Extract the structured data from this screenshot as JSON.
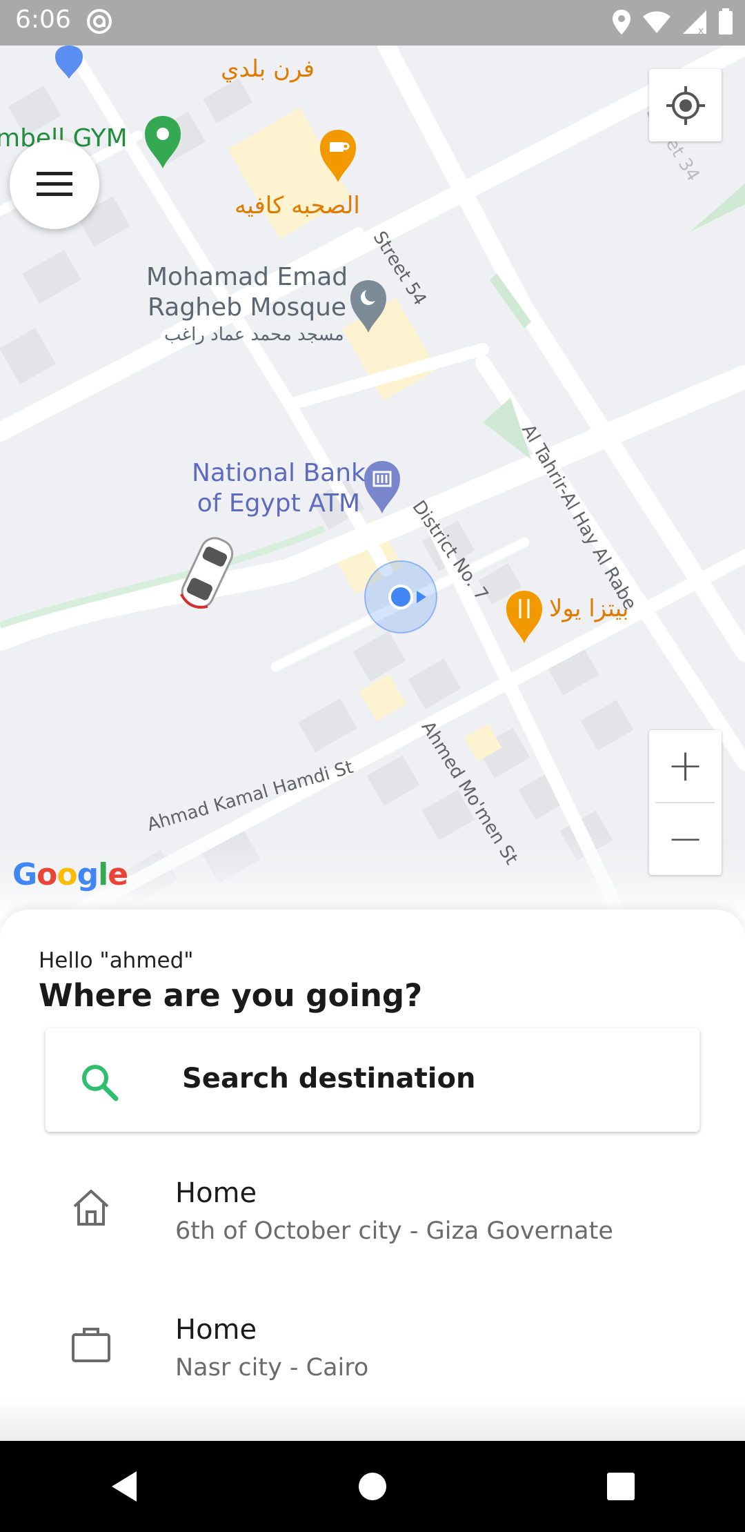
{
  "status_bar": {
    "time": "6:06",
    "icons": [
      "at-sign-icon",
      "location-icon",
      "wifi-icon",
      "signal-icon",
      "battery-icon"
    ]
  },
  "map": {
    "labels": {
      "bakery": "فرن بلدي",
      "gym": "mbell GYM",
      "cafe": "الصحبه كافيه",
      "street_54": "Street 54",
      "street_34": "Street 34",
      "mosque_line1": "Mohamad Emad",
      "mosque_line2": "Ragheb Mosque",
      "mosque_ar": "مسجد محمد عماد راغب",
      "bank_line1": "National Bank",
      "bank_line2": "of Egypt ATM",
      "district": "District No. 7",
      "tahrir": "Al Tahrir-Al Hay Al Rabe",
      "pizza": "بيتزا يولا",
      "ahmad_kamal": "Ahmad Kamal Hamdi St",
      "ahmed_momen": "Ahmed Mo'men St"
    },
    "google_logo": [
      "G",
      "o",
      "o",
      "g",
      "l",
      "e"
    ],
    "zoom_in": "+",
    "zoom_out": "−",
    "colors": {
      "background": "#eef0f3",
      "road": "#ffffff",
      "park": "#cfe9d4",
      "poi_blue": "#7986cb",
      "poi_orange": "#f29900",
      "poi_green": "#34a853",
      "location_dot": "#4285f4"
    }
  },
  "sheet": {
    "greeting": "Hello \"ahmed\"",
    "headline": "Where are you going?",
    "search": {
      "placeholder": "Search destination",
      "icon_color": "#2ebf6e"
    },
    "places": [
      {
        "icon": "home-icon",
        "title": "Home",
        "subtitle": "6th of October city - Giza Governate"
      },
      {
        "icon": "briefcase-icon",
        "title": "Home",
        "subtitle": "Nasr city - Cairo"
      }
    ]
  },
  "nav_bar": {
    "buttons": [
      "back-icon",
      "home-circle-icon",
      "recents-icon"
    ]
  }
}
